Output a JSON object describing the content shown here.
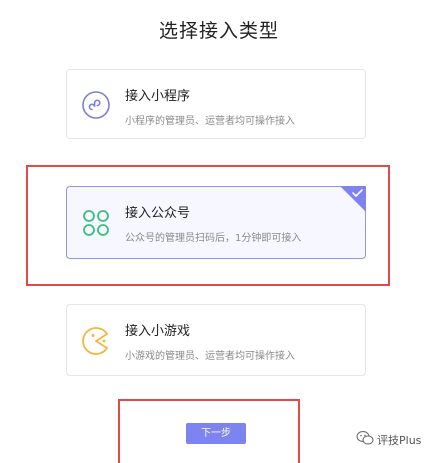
{
  "page": {
    "title": "选择接入类型"
  },
  "cards": [
    {
      "name": "接入小程序",
      "desc": "小程序的管理员、运营者均可操作接入",
      "icon": "mini-program-icon",
      "color": "#7a80d8",
      "selected": false
    },
    {
      "name": "接入公众号",
      "desc": "公众号的管理员扫码后，1分钟即可接入",
      "icon": "official-account-icon",
      "color": "#3dbf7b",
      "selected": true
    },
    {
      "name": "接入小游戏",
      "desc": "小游戏的管理员、运营者均可操作接入",
      "icon": "mini-game-icon",
      "color": "#f3b63c",
      "selected": false
    }
  ],
  "footer": {
    "next_label": "下一步"
  },
  "watermark": {
    "text": "评技Plus",
    "icon": "wechat-icon"
  },
  "colors": {
    "accent": "#7d83ef",
    "highlight": "#e24a4a",
    "selected_border": "#8e95f2"
  }
}
